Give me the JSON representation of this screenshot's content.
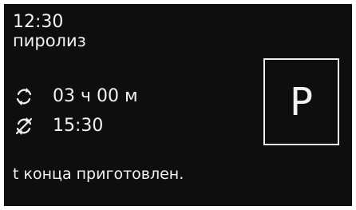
{
  "display": {
    "clock": "12:30",
    "program": "пиролиз",
    "duration": {
      "icon": "cycle-arrows-icon",
      "value": "03 ч 00 м"
    },
    "end_time": {
      "icon": "cycle-arrows-crossed-icon",
      "value": "15:30"
    },
    "status_text": "t конца приготовлен.",
    "mode_symbol": "P"
  },
  "colors": {
    "background": "#0e0e0e",
    "foreground": "#f2f2f2"
  }
}
